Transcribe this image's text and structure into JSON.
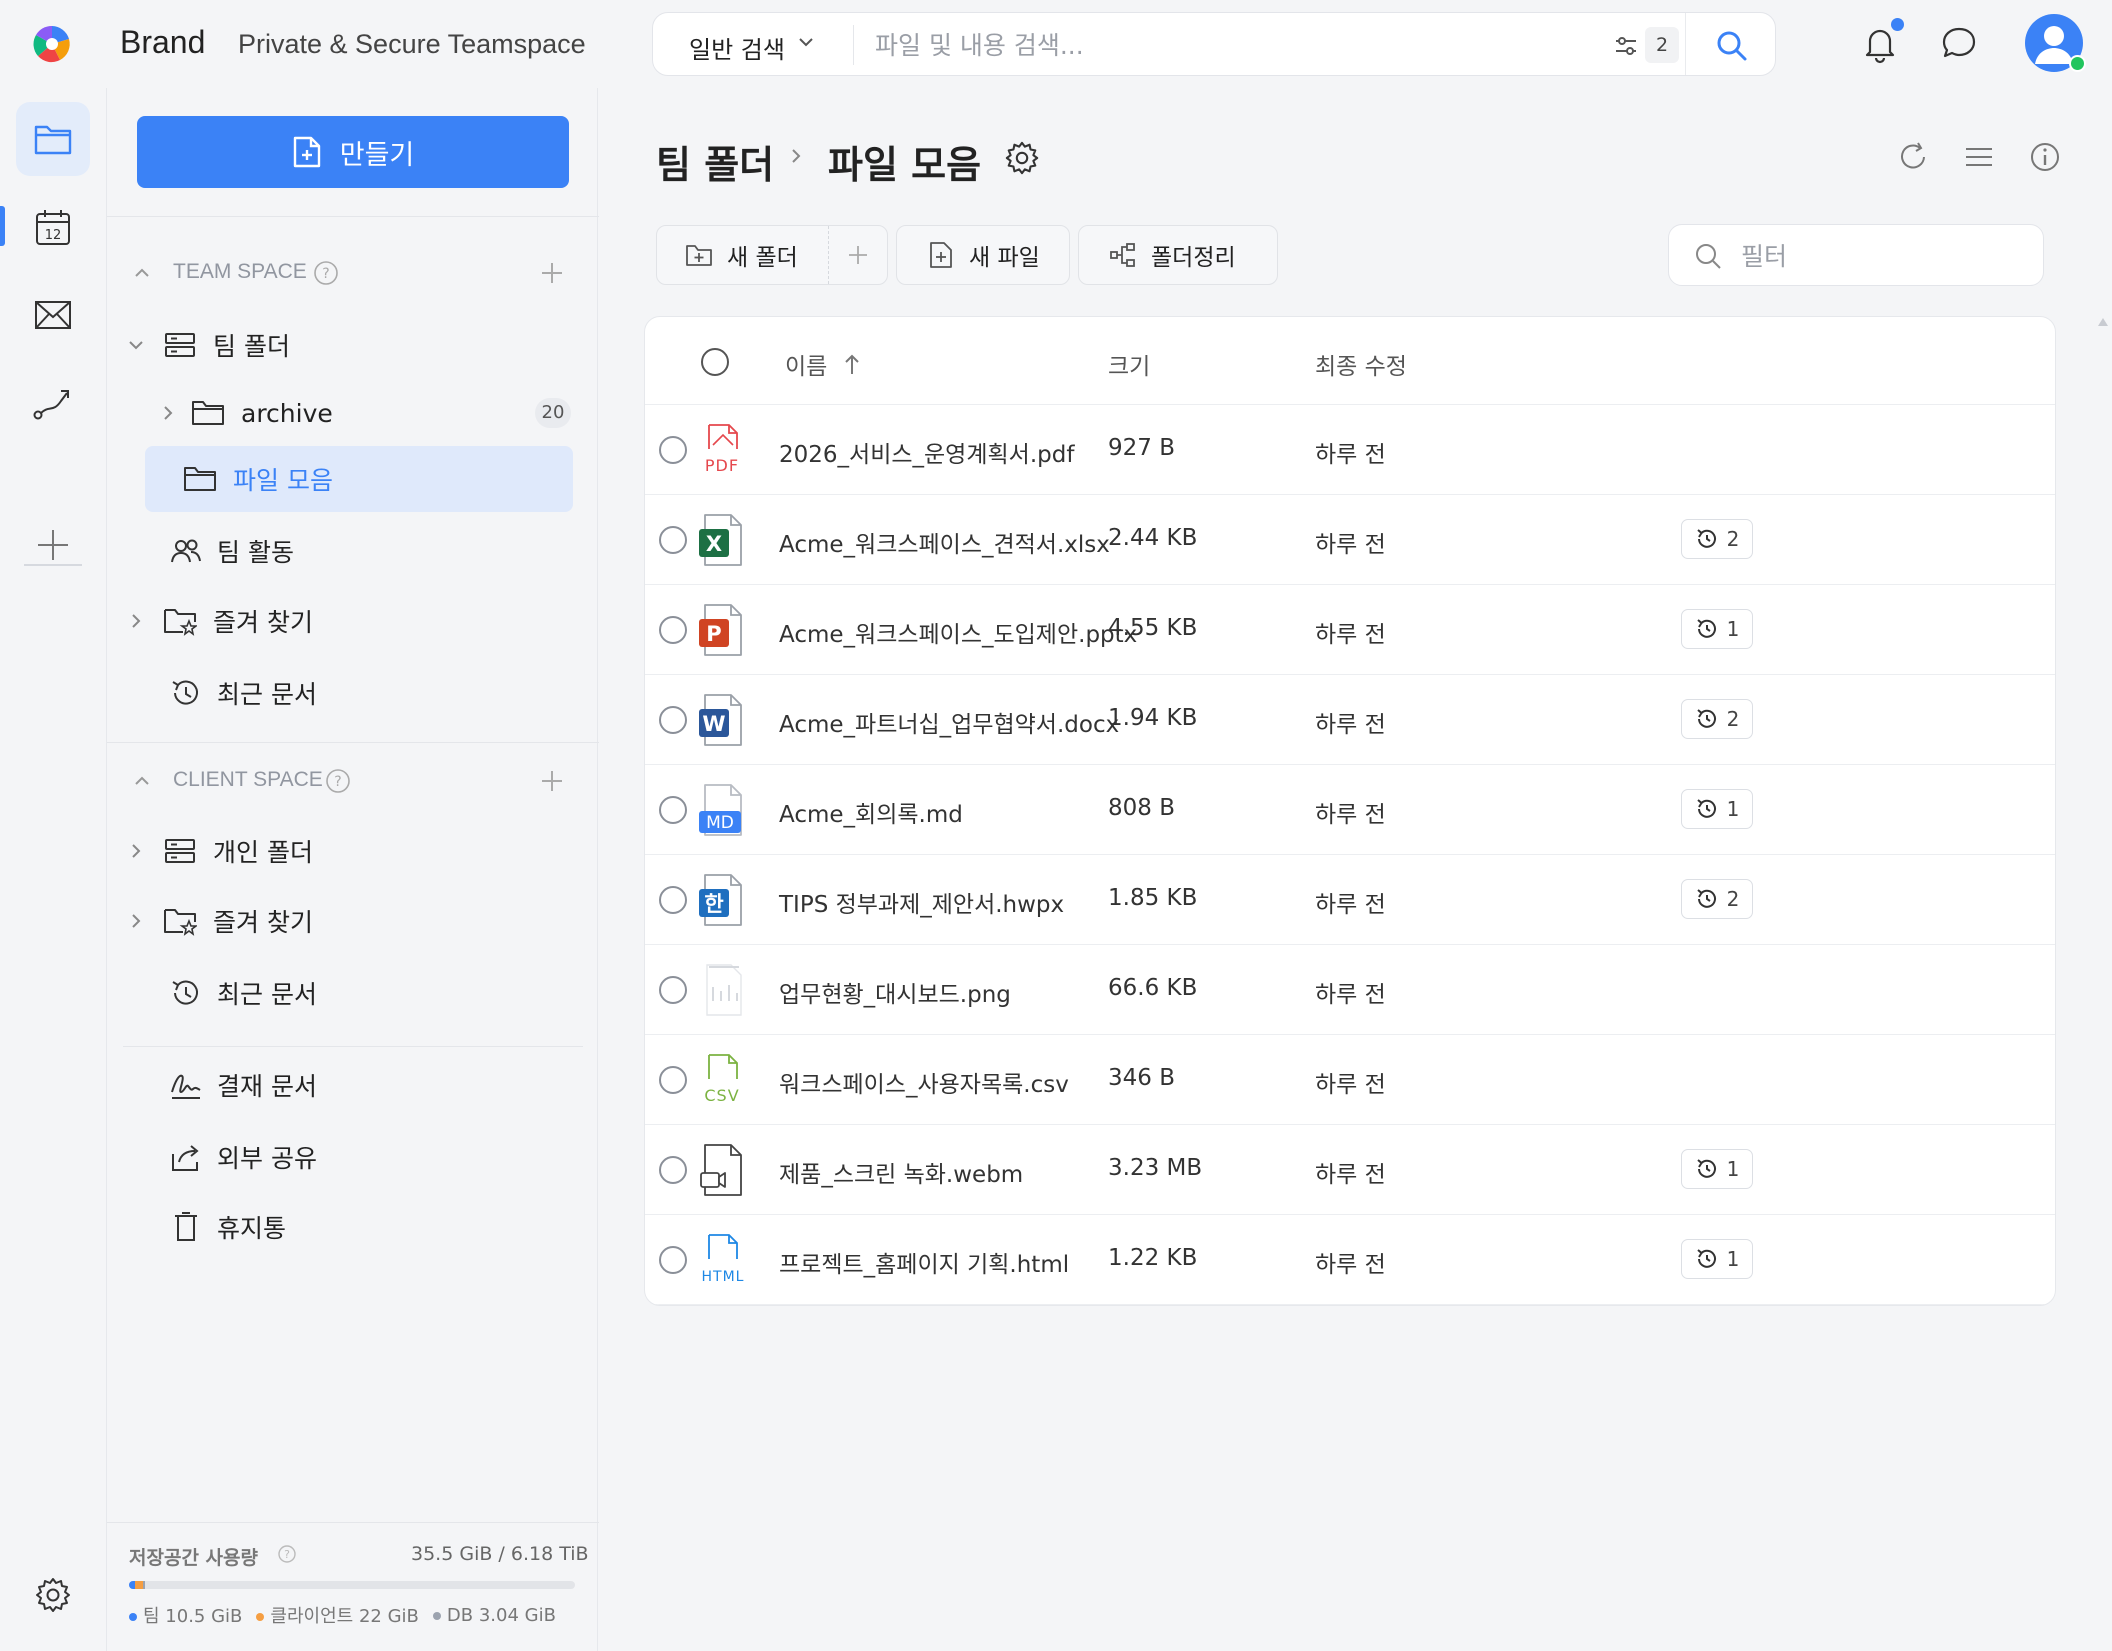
{
  "header": {
    "brand": "Brand",
    "subtitle": "Private & Secure Teamspace",
    "search_type": "일반 검색",
    "search_placeholder": "파일 및 내용 검색...",
    "filter_count": "2"
  },
  "sidebar": {
    "create_label": "만들기",
    "team_space_label": "TEAM SPACE",
    "client_space_label": "CLIENT SPACE",
    "team_items": [
      {
        "label": "팀 폴더"
      },
      {
        "label": "archive",
        "count": "20"
      },
      {
        "label": "파일 모음"
      },
      {
        "label": "팀 활동"
      },
      {
        "label": "즐겨 찾기"
      },
      {
        "label": "최근 문서"
      }
    ],
    "client_items": [
      {
        "label": "개인 폴더"
      },
      {
        "label": "즐겨 찾기"
      },
      {
        "label": "최근 문서"
      }
    ],
    "misc_items": [
      {
        "label": "결재 문서"
      },
      {
        "label": "외부 공유"
      },
      {
        "label": "휴지통"
      }
    ],
    "storage": {
      "title": "저장공간 사용량",
      "value": "35.5 GiB / 6.18 TiB",
      "legend": [
        {
          "label": "팀",
          "amount": "10.5 GiB",
          "color": "#3b82f6"
        },
        {
          "label": "클라이언트",
          "amount": "22 GiB",
          "color": "#f59e42"
        },
        {
          "label": "DB",
          "amount": "3.04 GiB",
          "color": "#9ca3af"
        }
      ]
    }
  },
  "main": {
    "breadcrumb_root": "팀 폴더",
    "breadcrumb_current": "파일 모음",
    "toolbar": {
      "new_folder": "새 폴더",
      "new_file": "새 파일",
      "organize": "폴더정리",
      "filter_placeholder": "필터"
    },
    "columns": {
      "name": "이름",
      "size": "크기",
      "modified": "최종 수정"
    },
    "files": [
      {
        "name": "2026_서비스_운영계획서.pdf",
        "size": "927 B",
        "modified": "하루 전",
        "versions": "",
        "type": "pdf"
      },
      {
        "name": "Acme_워크스페이스_견적서.xlsx",
        "size": "2.44 KB",
        "modified": "하루 전",
        "versions": "2",
        "type": "xlsx"
      },
      {
        "name": "Acme_워크스페이스_도입제안.pptx",
        "size": "4.55 KB",
        "modified": "하루 전",
        "versions": "1",
        "type": "pptx"
      },
      {
        "name": "Acme_파트너십_업무협약서.docx",
        "size": "1.94 KB",
        "modified": "하루 전",
        "versions": "2",
        "type": "docx"
      },
      {
        "name": "Acme_회의록.md",
        "size": "808 B",
        "modified": "하루 전",
        "versions": "1",
        "type": "md"
      },
      {
        "name": "TIPS 정부과제_제안서.hwpx",
        "size": "1.85 KB",
        "modified": "하루 전",
        "versions": "2",
        "type": "hwpx"
      },
      {
        "name": "업무현황_대시보드.png",
        "size": "66.6 KB",
        "modified": "하루 전",
        "versions": "",
        "type": "png"
      },
      {
        "name": "워크스페이스_사용자목록.csv",
        "size": "346 B",
        "modified": "하루 전",
        "versions": "",
        "type": "csv"
      },
      {
        "name": "제품_스크린 녹화.webm",
        "size": "3.23 MB",
        "modified": "하루 전",
        "versions": "1",
        "type": "webm"
      },
      {
        "name": "프로젝트_홈페이지 기획.html",
        "size": "1.22 KB",
        "modified": "하루 전",
        "versions": "1",
        "type": "html"
      }
    ]
  },
  "icon_text": {
    "pdf": "PDF",
    "xlsx": "X",
    "pptx": "P",
    "docx": "W",
    "md": "MD",
    "hwpx": "한",
    "csv": "CSV",
    "html": "HTML",
    "calendar_day": "12"
  },
  "colors": {
    "accent": "#3b82f6",
    "pdf": "#e5484d",
    "xlsx": "#1d7044",
    "pptx": "#d04423",
    "docx": "#2b579a",
    "hwpx": "#1f6fbf",
    "csv": "#7cb342",
    "html": "#1e88e5",
    "online": "#22c55e"
  }
}
